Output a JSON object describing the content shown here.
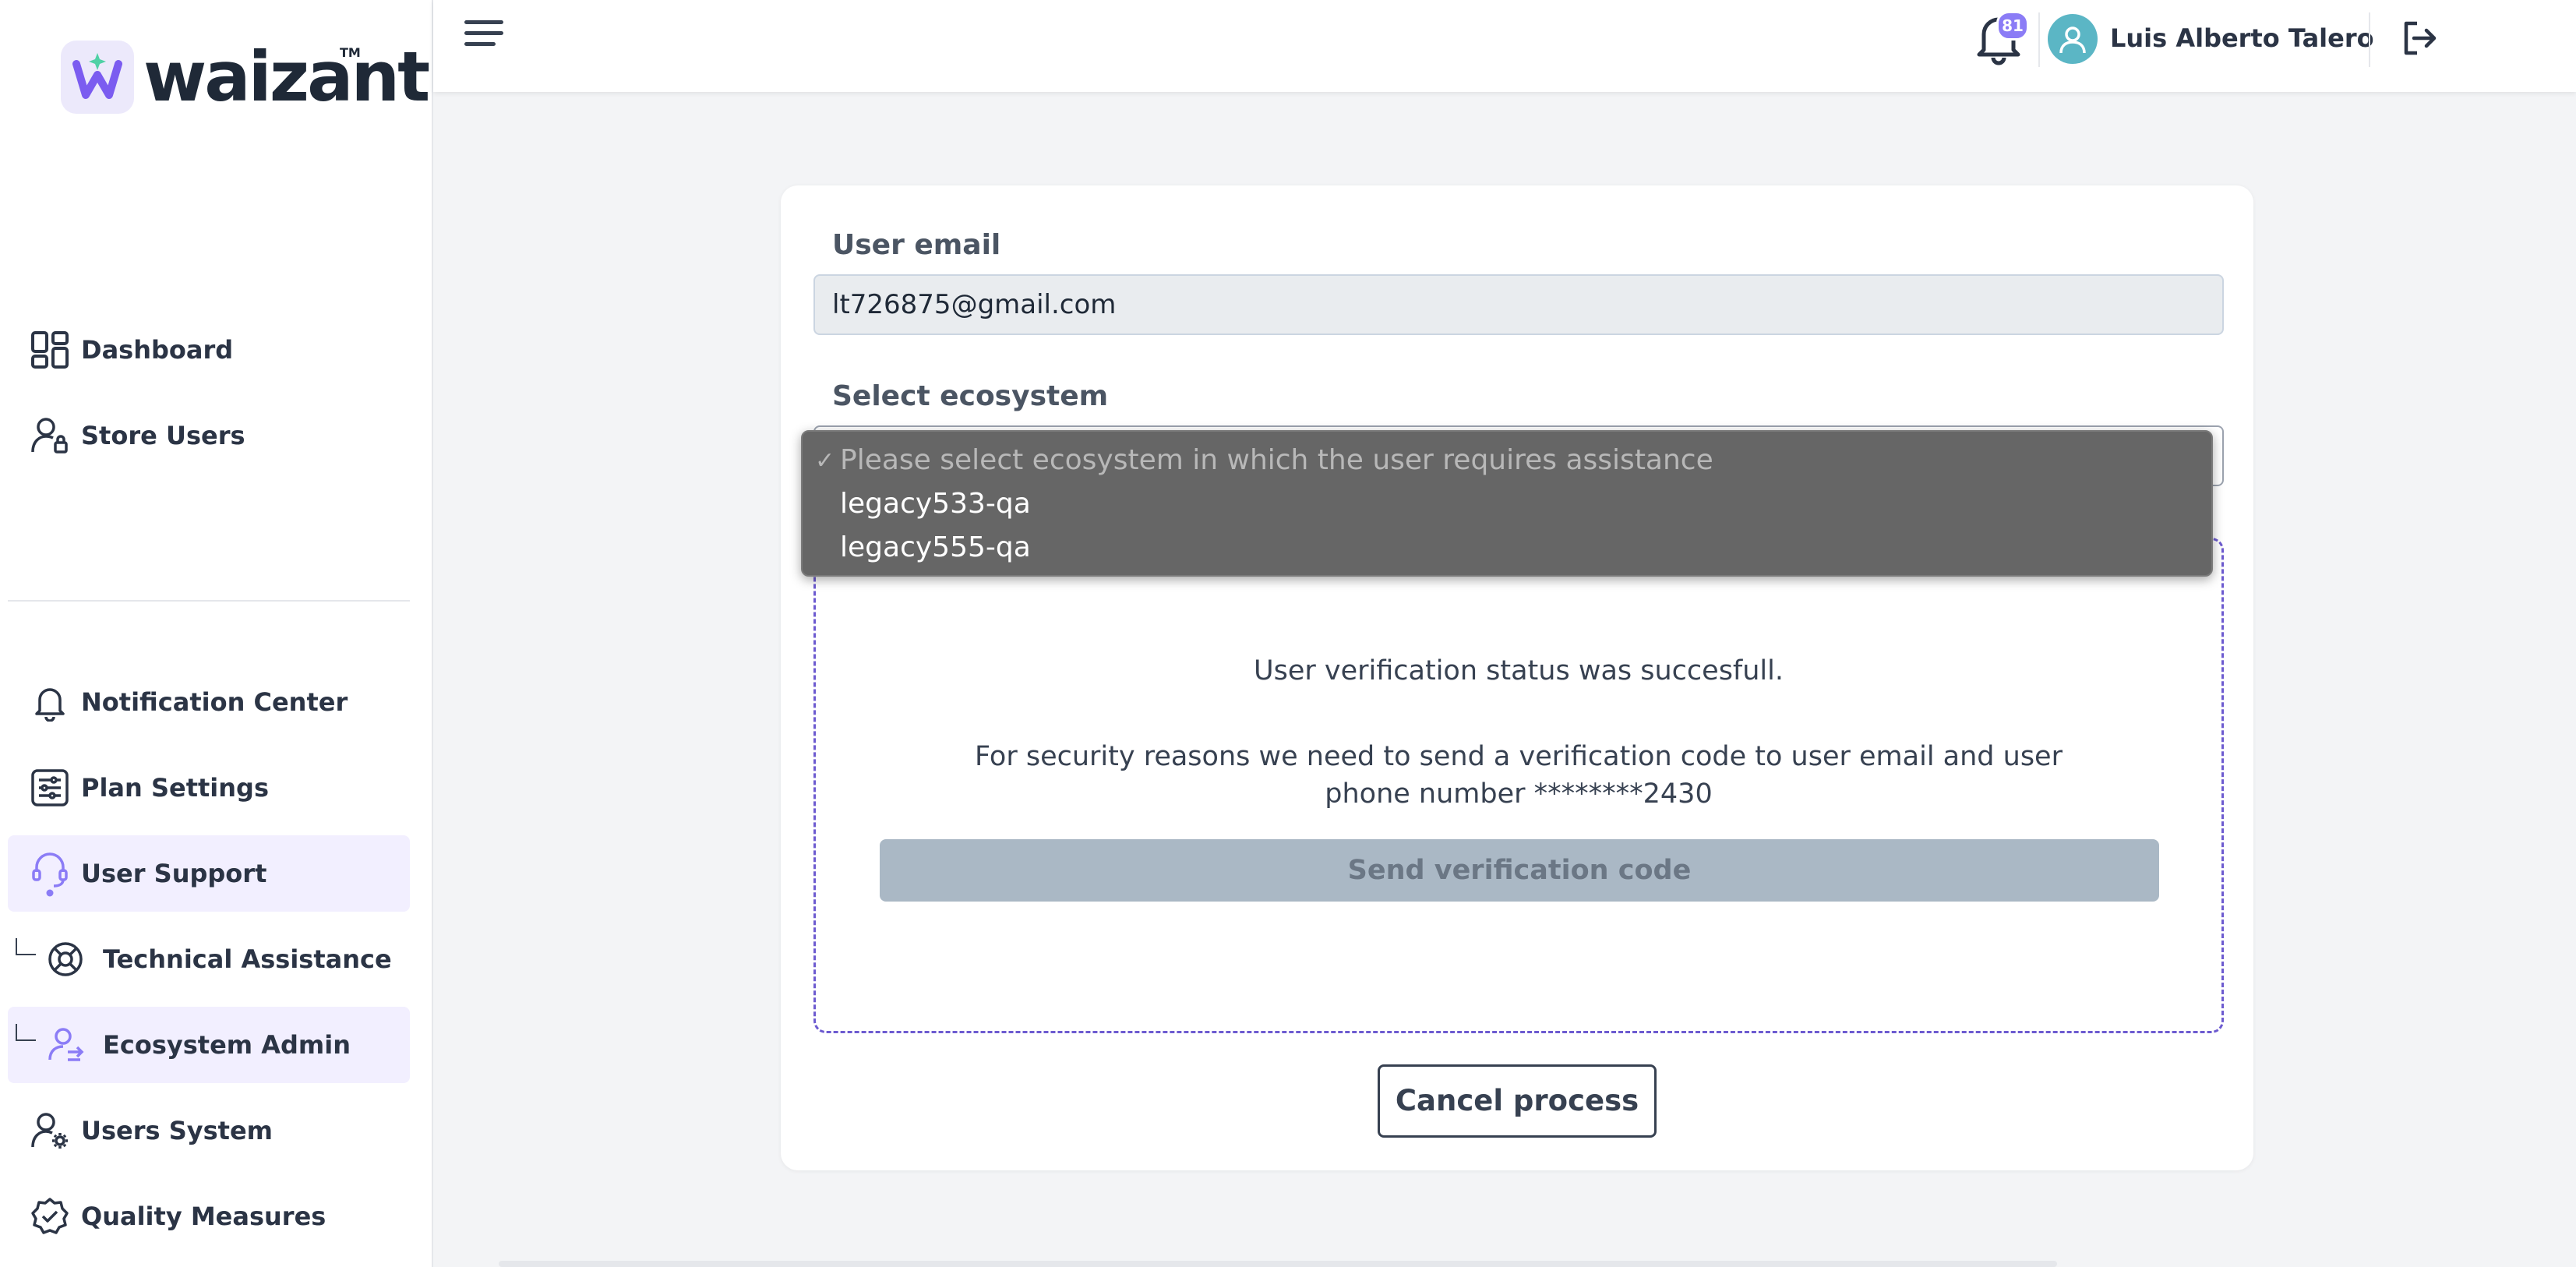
{
  "brand": {
    "name": "waizant",
    "tm": "TM",
    "accent": "#8b7cf6"
  },
  "sidebar": {
    "items": [
      {
        "label": "Dashboard",
        "icon": "dashboard-grid-icon"
      },
      {
        "label": "Store Users",
        "icon": "user-lock-icon"
      },
      {
        "label": "Notification Center",
        "icon": "bell-icon"
      },
      {
        "label": "Plan Settings",
        "icon": "sliders-icon"
      },
      {
        "label": "User Support",
        "icon": "headset-icon",
        "active": true
      },
      {
        "label": "Technical Assistance",
        "icon": "lifebuoy-icon",
        "sub": true
      },
      {
        "label": "Ecosystem Admin",
        "icon": "user-transfer-icon",
        "sub": true,
        "active": true
      },
      {
        "label": "Users System",
        "icon": "user-gear-icon"
      },
      {
        "label": "Quality Measures",
        "icon": "badge-check-icon"
      }
    ]
  },
  "header": {
    "notification_count": "81",
    "user_name": "Luis Alberto Talero"
  },
  "form": {
    "email_label": "User email",
    "email_value": "lt726875@gmail.com",
    "ecosystem_label": "Select ecosystem",
    "ecosystem_options": [
      "Please select ecosystem in which the user requires assistance",
      "legacy533-qa",
      "legacy555-qa"
    ],
    "selected_check": "✓",
    "verification_status": "User verification status was succesfull.",
    "verification_message": "For security reasons we need to send a verification code to user email and user phone number ********2430",
    "send_button": "Send verification code",
    "cancel_button": "Cancel process"
  }
}
